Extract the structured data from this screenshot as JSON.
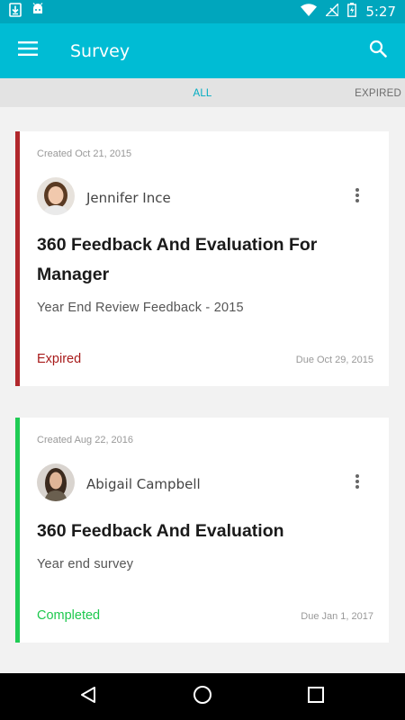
{
  "status_bar": {
    "time": "5:27",
    "icons": [
      "download-icon",
      "android-icon",
      "wifi-icon",
      "no-signal-icon",
      "battery-charging-icon"
    ]
  },
  "app_bar": {
    "title": "Survey",
    "menu_icon": "menu-icon",
    "search_icon": "search-icon"
  },
  "tabs": {
    "all": "ALL",
    "expired": "EXPIRED",
    "active": "all",
    "active_color": "#00acc1"
  },
  "surveys": [
    {
      "created": "Created Oct 21, 2015",
      "author": "Jennifer Ince",
      "title": "360 Feedback And Evaluation For Manager",
      "description": "Year End Review Feedback - 2015",
      "status": "Expired",
      "status_color": "#a81b1b",
      "due": "Due Oct 29, 2015"
    },
    {
      "created": "Created Aug 22, 2016",
      "author": "Abigail Campbell",
      "title": "360 Feedback And Evaluation",
      "description": "Year end survey",
      "status": "Completed",
      "status_color": "#1ec84e",
      "due": "Due Jan 1, 2017"
    }
  ],
  "nav_bar": {
    "icons": [
      "back-icon",
      "home-icon",
      "recents-icon"
    ]
  }
}
